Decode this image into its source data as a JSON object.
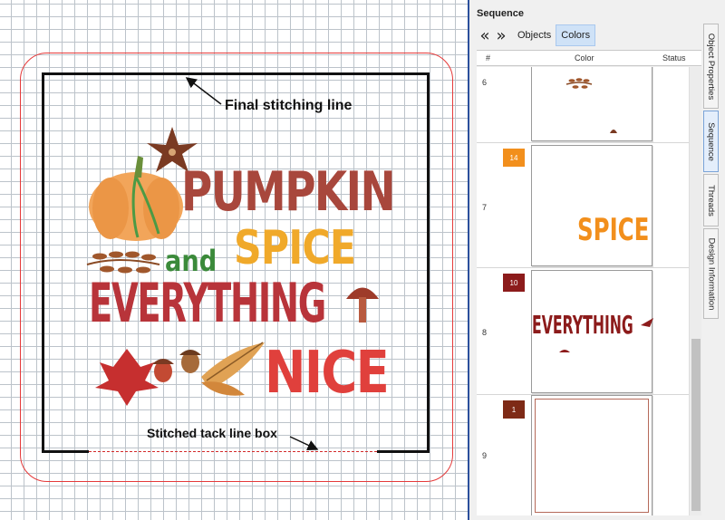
{
  "canvas": {
    "annotations": {
      "final_label": "Final stitching line",
      "tack_label": "Stitched tack line box"
    },
    "design_text": {
      "line1": "PUMPKIN",
      "line2a": "and",
      "line2b": "SPICE",
      "line3": "EVERYTHING",
      "line4": "NICE"
    },
    "colors": {
      "hoop": "#e53a3a",
      "stitch_line": "#111111",
      "tack_line": "#d32b2b",
      "grid": "#bcc3ca"
    }
  },
  "panel": {
    "title": "Sequence",
    "nav_prev_icon": "double-chevron-left-icon",
    "nav_next_icon": "double-chevron-right-icon",
    "tabs": [
      {
        "label": "Objects",
        "active": false
      },
      {
        "label": "Colors",
        "active": true
      }
    ],
    "columns": {
      "num": "#",
      "color": "Color",
      "status": "Status"
    },
    "rows": [
      {
        "num": "6",
        "swatch": "",
        "swatch_color": "",
        "thumb_text": ""
      },
      {
        "num": "7",
        "swatch": "14",
        "swatch_color": "#f28f1c",
        "thumb_text": "SPICE"
      },
      {
        "num": "8",
        "swatch": "10",
        "swatch_color": "#8c1b1b",
        "thumb_text": "EVERYTHING"
      },
      {
        "num": "9",
        "swatch": "1",
        "swatch_color": "#7e2a16",
        "thumb_text": ""
      }
    ],
    "side_tabs": [
      {
        "label": "Object Properties",
        "active": false
      },
      {
        "label": "Sequence",
        "active": true
      },
      {
        "label": "Threads",
        "active": false
      },
      {
        "label": "Design Information",
        "active": false
      }
    ]
  }
}
